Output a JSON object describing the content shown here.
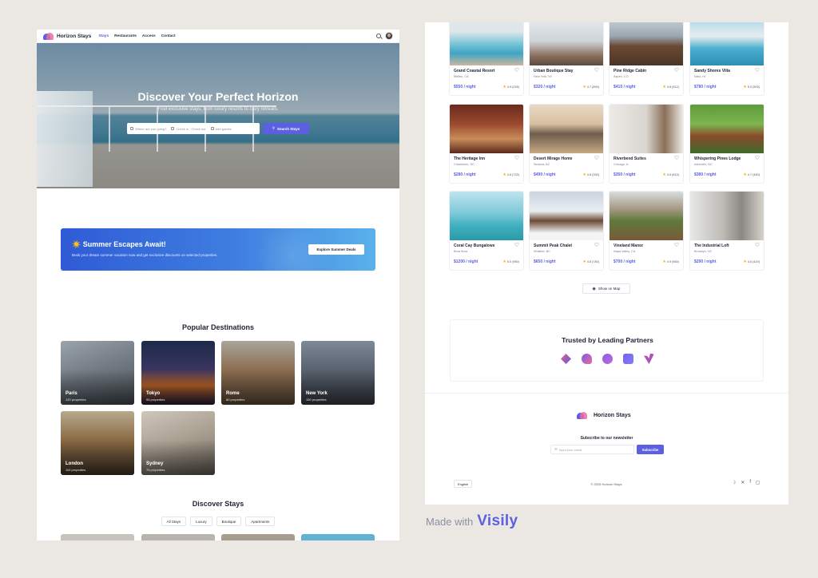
{
  "nav": {
    "brand": "Horizon Stays",
    "links": [
      {
        "label": "Stays",
        "active": true
      },
      {
        "label": "Restaurants",
        "active": false
      },
      {
        "label": "Access",
        "active": false
      },
      {
        "label": "Contact",
        "active": false
      }
    ]
  },
  "hero": {
    "title": "Discover Your Perfect Horizon",
    "subtitle": "Find exclusive stays, from luxury resorts to cozy retreats.",
    "where_placeholder": "Where are you going?",
    "dates_placeholder": "Check in - Check out",
    "guests_placeholder": "Add guests",
    "search_label": "Search Stays"
  },
  "promo": {
    "title": "☀️ Summer Escapes Await!",
    "text": "Book your dream summer vacation now and get exclusive discounts on selected properties.",
    "button": "Explore Summer Deals"
  },
  "destinations": {
    "title": "Popular Destinations",
    "items": [
      {
        "name": "Paris",
        "count": "120 properties"
      },
      {
        "name": "Tokyo",
        "count": "95 properties"
      },
      {
        "name": "Rome",
        "count": "80 properties"
      },
      {
        "name": "New York",
        "count": "150 properties"
      },
      {
        "name": "London",
        "count": "110 properties"
      },
      {
        "name": "Sydney",
        "count": "75 properties"
      }
    ]
  },
  "discover": {
    "title": "Discover Stays",
    "filters": [
      "All Stays",
      "Luxury",
      "Boutique",
      "Apartments"
    ]
  },
  "stays": [
    {
      "name": "Grand Coastal Resort",
      "location": "Malibu, CA",
      "price": "$550 / night",
      "rating": "4.9 (245)"
    },
    {
      "name": "Urban Boutique Stay",
      "location": "New York, NY",
      "price": "$320 / night",
      "rating": "4.7 (890)"
    },
    {
      "name": "Pine Ridge Cabin",
      "location": "Aspen, CO",
      "price": "$410 / night",
      "rating": "4.8 (512)"
    },
    {
      "name": "Sandy Shores Villa",
      "location": "Maui, HI",
      "price": "$780 / night",
      "rating": "5.0 (500)"
    },
    {
      "name": "The Heritage Inn",
      "location": "Charleston, SC",
      "price": "$280 / night",
      "rating": "4.6 (720)"
    },
    {
      "name": "Desert Mirage Home",
      "location": "Sedona, AZ",
      "price": "$490 / night",
      "rating": "4.8 (330)"
    },
    {
      "name": "Riverbend Suites",
      "location": "Chicago, IL",
      "price": "$350 / night",
      "rating": "4.5 (610)"
    },
    {
      "name": "Whispering Pines Lodge",
      "location": "Asheville, NC",
      "price": "$380 / night",
      "rating": "4.7 (480)"
    },
    {
      "name": "Coral Cay Bungalows",
      "location": "Bora Bora",
      "price": "$1200 / night",
      "rating": "5.0 (950)"
    },
    {
      "name": "Summit Peak Chalet",
      "location": "Whistler, BC",
      "price": "$650 / night",
      "rating": "4.8 (780)"
    },
    {
      "name": "Vineland Manor",
      "location": "Napa Valley, CA",
      "price": "$700 / night",
      "rating": "4.9 (560)"
    },
    {
      "name": "The Industrial Loft",
      "location": "Brooklyn, NY",
      "price": "$290 / night",
      "rating": "4.6 (420)"
    }
  ],
  "map_button": "Show on Map",
  "partners_title": "Trusted by Leading Partners",
  "partner_colors": [
    "#e85d8a",
    "#7b5be0",
    "#8a5fe8",
    "#6b63f0",
    "#d84f8f"
  ],
  "footer": {
    "brand": "Horizon Stays",
    "newsletter_title": "Subscribe to our newsletter",
    "email_placeholder": "Input your email",
    "subscribe": "Subscribe",
    "language": "English",
    "copyright": "© 2025 Horizon Stays."
  },
  "credit": {
    "made_with": "Made with",
    "brand": "Visily"
  },
  "colors": {
    "accent": "#5b5fe0",
    "brand_pink": "#e66fa1"
  }
}
